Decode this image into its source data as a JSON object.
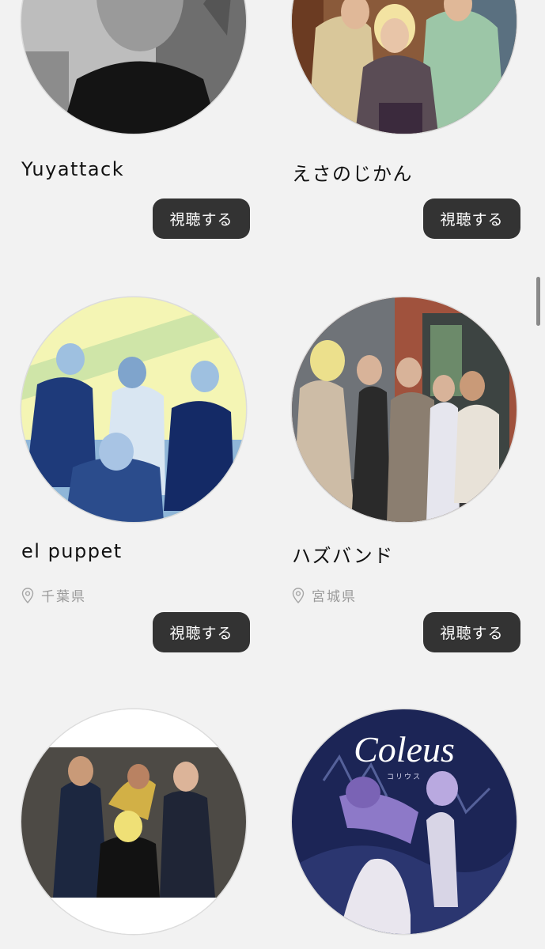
{
  "artists": [
    {
      "name": "Yuyattack",
      "button": "視聴する",
      "photo": "bw-portrait-photo"
    },
    {
      "name": "えさのじかん",
      "button": "視聴する",
      "photo": "group-sitting-photo"
    },
    {
      "name": "el puppet",
      "location": "千葉県",
      "button": "視聴する",
      "photo": "blue-yellow-band-photo"
    },
    {
      "name": "ハズバンド",
      "location": "宮城県",
      "button": "視聴する",
      "photo": "band-by-brick-wall-photo"
    },
    {
      "photo": "band-dark-studio-photo"
    },
    {
      "photo": "coleus-artwork",
      "artwork_title": "Coleus",
      "artwork_subtitle": "コリウス"
    }
  ],
  "colors": {
    "background": "#f2f2f2",
    "button": "#333333",
    "button_text": "#ffffff",
    "location_text": "#9a9a9a"
  },
  "icons": {
    "location": "map-pin-icon"
  }
}
